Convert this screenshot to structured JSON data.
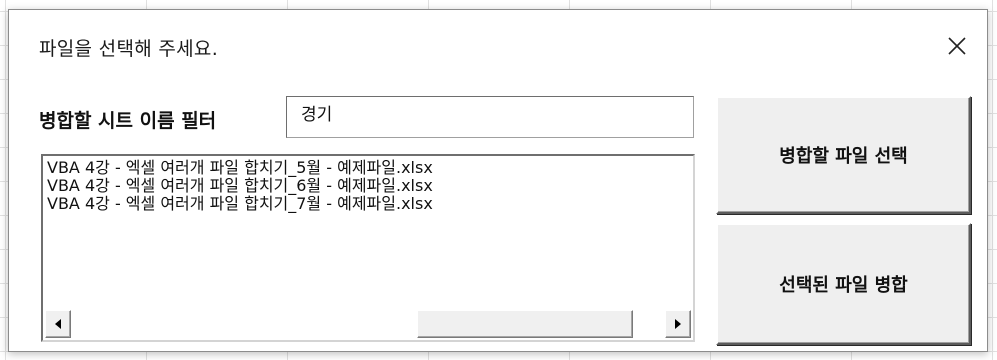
{
  "form": {
    "title": "파일을 선택해 주세요.",
    "close_glyph": "close-icon"
  },
  "filter": {
    "label": "병합할 시트 이름 필터",
    "value": "경기"
  },
  "file_list": {
    "items": [
      "VBA 4강 - 엑셀 여러개 파일 합치기_5월 - 예제파일.xlsx",
      "VBA 4강 - 엑셀 여러개 파일 합치기_6월 - 예제파일.xlsx",
      "VBA 4강 - 엑셀 여러개 파일 합치기_7월 - 예제파일.xlsx"
    ],
    "scrollbar": {
      "left_icon": "arrow-left-icon",
      "right_icon": "arrow-right-icon"
    }
  },
  "buttons": {
    "select_files": "병합할 파일 선택",
    "merge_selected": "선택된 파일 병합"
  },
  "colors": {
    "window_bg": "#ffffff",
    "button_face": "#efefef",
    "grid_line": "#e1e1e1"
  }
}
